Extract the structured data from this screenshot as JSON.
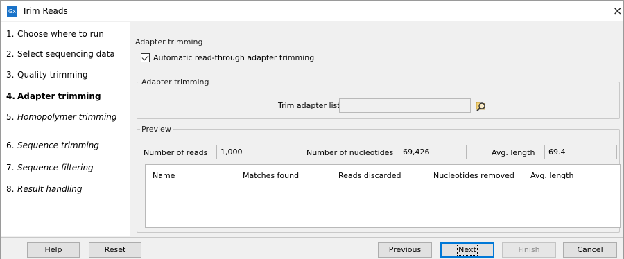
{
  "window": {
    "app_icon": "Gx",
    "title": "Trim Reads",
    "close": "×"
  },
  "steps": [
    {
      "num": "1.",
      "label": "Choose where to run",
      "state": "done"
    },
    {
      "num": "2.",
      "label": "Select sequencing data",
      "state": "done"
    },
    {
      "num": "3.",
      "label": "Quality trimming",
      "state": "done"
    },
    {
      "num": "4.",
      "label": "Adapter trimming",
      "state": "current"
    },
    {
      "num": "5.",
      "label": "Homopolymer trimming",
      "state": "future"
    },
    {
      "num": "6.",
      "label": "Sequence trimming",
      "state": "future"
    },
    {
      "num": "7.",
      "label": "Sequence filtering",
      "state": "future"
    },
    {
      "num": "8.",
      "label": "Result handling",
      "state": "future"
    }
  ],
  "content": {
    "section_title": "Adapter trimming",
    "auto_trim": {
      "label": "Automatic read-through adapter trimming",
      "checked": true
    },
    "adapter_group": {
      "legend": "Adapter trimming",
      "trim_list_label": "Trim adapter list",
      "trim_list_value": "",
      "browse_icon": "browse-magnifier-icon"
    },
    "preview": {
      "legend": "Preview",
      "reads_label": "Number of reads",
      "reads_value": "1,000",
      "nucleotides_label": "Number of nucleotides",
      "nucleotides_value": "69,426",
      "avg_label": "Avg. length",
      "avg_value": "69.4",
      "columns": [
        "Name",
        "Matches found",
        "Reads discarded",
        "Nucleotides removed",
        "Avg. length"
      ],
      "rows": []
    }
  },
  "buttons": {
    "help": "Help",
    "reset": "Reset",
    "previous": "Previous",
    "next": "Next",
    "finish": "Finish",
    "cancel": "Cancel"
  },
  "colors": {
    "accent": "#0078d7",
    "app_icon_bg": "#1a73c9",
    "window_bg": "#f0f0f0"
  }
}
